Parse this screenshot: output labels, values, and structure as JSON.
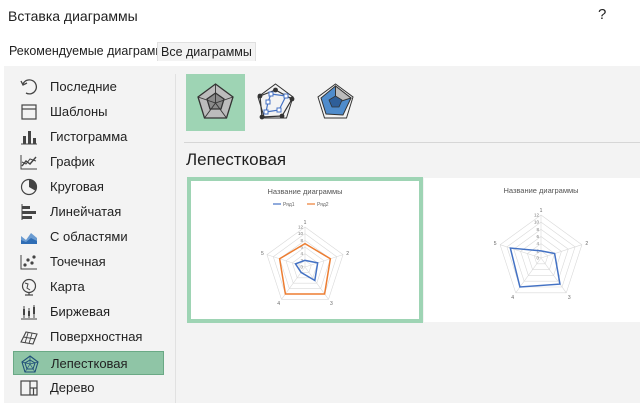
{
  "dialog": {
    "title": "Вставка диаграммы",
    "help": "?"
  },
  "tabs": [
    {
      "label": "Рекомендуемые диаграммы",
      "selected": false
    },
    {
      "label": "Все диаграммы",
      "selected": true
    }
  ],
  "sidebar": {
    "items": [
      {
        "label": "Последние",
        "icon": "recent-icon"
      },
      {
        "label": "Шаблоны",
        "icon": "templates-icon"
      },
      {
        "label": "Гистограмма",
        "icon": "column-chart-icon"
      },
      {
        "label": "График",
        "icon": "line-chart-icon"
      },
      {
        "label": "Круговая",
        "icon": "pie-chart-icon"
      },
      {
        "label": "Линейчатая",
        "icon": "bar-chart-icon"
      },
      {
        "label": "С областями",
        "icon": "area-chart-icon"
      },
      {
        "label": "Точечная",
        "icon": "scatter-chart-icon"
      },
      {
        "label": "Карта",
        "icon": "map-chart-icon"
      },
      {
        "label": "Биржевая",
        "icon": "stock-chart-icon"
      },
      {
        "label": "Поверхностная",
        "icon": "surface-chart-icon"
      },
      {
        "label": "Лепестковая",
        "icon": "radar-chart-icon",
        "active": true
      },
      {
        "label": "Дерево",
        "icon": "treemap-chart-icon"
      }
    ]
  },
  "main": {
    "subtypes": [
      {
        "name": "radar",
        "selected": true
      },
      {
        "name": "radar-with-markers",
        "selected": false
      },
      {
        "name": "filled-radar",
        "selected": false
      }
    ],
    "section_title": "Лепестковая",
    "previews": [
      {
        "title": "Название диаграммы",
        "legend": [
          "Ряд1",
          "Ряд2"
        ],
        "selected": true
      },
      {
        "title": "Название диаграммы",
        "selected": false
      }
    ]
  },
  "chart_data": [
    {
      "type": "radar",
      "title": "Название диаграммы",
      "categories": [
        "1",
        "2",
        "3",
        "4",
        "5"
      ],
      "scale_ticks": [
        "0",
        "2",
        "4",
        "6",
        "8",
        "10",
        "12"
      ],
      "ylim": [
        0,
        12
      ],
      "series": [
        {
          "name": "Ряд1",
          "values": [
            2,
            4,
            5,
            2,
            3
          ],
          "color": "#4472c4"
        },
        {
          "name": "Ряд2",
          "values": [
            7,
            8,
            10,
            10,
            8
          ],
          "color": "#ed7d31"
        }
      ]
    },
    {
      "type": "radar",
      "title": "Название диаграммы",
      "categories": [
        "1",
        "2",
        "3",
        "4",
        "5"
      ],
      "scale_ticks": [
        "0",
        "2",
        "4",
        "6",
        "8",
        "10",
        "12"
      ],
      "ylim": [
        0,
        12
      ],
      "series": [
        {
          "values": [
            2,
            4,
            9,
            10,
            9
          ],
          "color": "#4472c4"
        }
      ]
    }
  ],
  "colors": {
    "accent": "#9ed4b4",
    "active_item": "#8fc5a6",
    "pane": "#f3f3f3",
    "series1": "#4472c4",
    "series2": "#ed7d31"
  }
}
